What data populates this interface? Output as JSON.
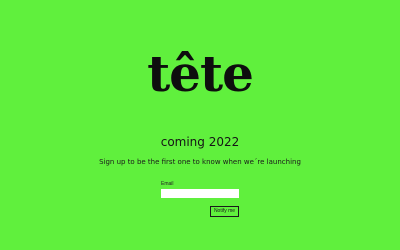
{
  "brand": {
    "logo_text": "tête"
  },
  "hero": {
    "headline": "coming 2022",
    "subtitle": "Sign up to be the first one to know when we´re launching"
  },
  "signup_form": {
    "email_label": "Email",
    "email_value": "",
    "email_placeholder": "",
    "submit_label": "Notify me"
  },
  "colors": {
    "background": "#60f03d",
    "text": "#111111",
    "input_background": "#ffffff"
  }
}
